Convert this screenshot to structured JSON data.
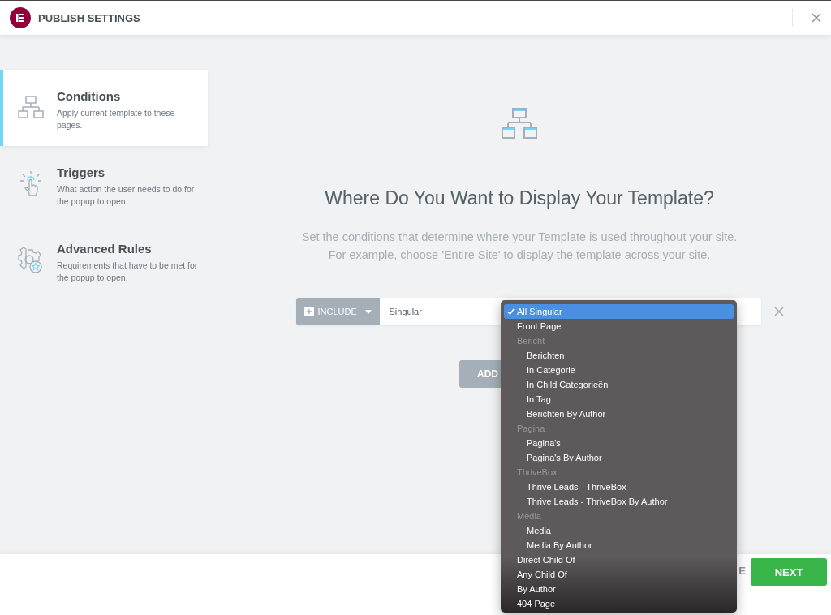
{
  "header": {
    "title": "PUBLISH SETTINGS"
  },
  "sidebar": {
    "items": [
      {
        "kind": "conditions",
        "title": "Conditions",
        "description": "Apply current template to these pages.",
        "selected": true
      },
      {
        "kind": "triggers",
        "title": "Triggers",
        "description": "What action the user needs to do for the popup to open.",
        "selected": false
      },
      {
        "kind": "rules",
        "title": "Advanced Rules",
        "description": "Requirements that have to be met for the popup to open.",
        "selected": false
      }
    ]
  },
  "main": {
    "title": "Where Do You Want to Display Your Template?",
    "description": [
      "Set the conditions that determine where your Template is used throughout your site.",
      "For example, choose 'Entire Site' to display the template across your site."
    ],
    "condition": {
      "type": "INCLUDE",
      "value": "Singular"
    },
    "add_button": "ADD"
  },
  "dropdown": {
    "options": [
      {
        "kind": "option",
        "label": "All Singular",
        "selected": true
      },
      {
        "kind": "option",
        "label": "Front Page",
        "selected": false
      },
      {
        "kind": "group",
        "label": "Bericht",
        "children": [
          {
            "kind": "option",
            "label": "Berichten",
            "selected": false
          },
          {
            "kind": "option",
            "label": "In Categorie",
            "selected": false
          },
          {
            "kind": "option",
            "label": "In Child Categorieën",
            "selected": false
          },
          {
            "kind": "option",
            "label": "In Tag",
            "selected": false
          },
          {
            "kind": "option",
            "label": "Berichten By Author",
            "selected": false
          }
        ]
      },
      {
        "kind": "group",
        "label": "Pagina",
        "children": [
          {
            "kind": "option",
            "label": "Pagina's",
            "selected": false
          },
          {
            "kind": "option",
            "label": "Pagina's By Author",
            "selected": false
          }
        ]
      },
      {
        "kind": "group",
        "label": "ThriveBox",
        "children": [
          {
            "kind": "option",
            "label": "Thrive Leads - ThriveBox",
            "selected": false
          },
          {
            "kind": "option",
            "label": "Thrive Leads - ThriveBox By Author",
            "selected": false
          }
        ]
      },
      {
        "kind": "group",
        "label": "Media",
        "children": [
          {
            "kind": "option",
            "label": "Media",
            "selected": false
          },
          {
            "kind": "option",
            "label": "Media By Author",
            "selected": false
          }
        ]
      },
      {
        "kind": "option",
        "label": "Direct Child Of",
        "selected": false
      },
      {
        "kind": "option",
        "label": "Any Child Of",
        "selected": false
      },
      {
        "kind": "option",
        "label": "By Author",
        "selected": false
      },
      {
        "kind": "option",
        "label": "404 Page",
        "selected": false
      }
    ]
  },
  "footer": {
    "secondary_button": "E",
    "next_button": "NEXT"
  }
}
